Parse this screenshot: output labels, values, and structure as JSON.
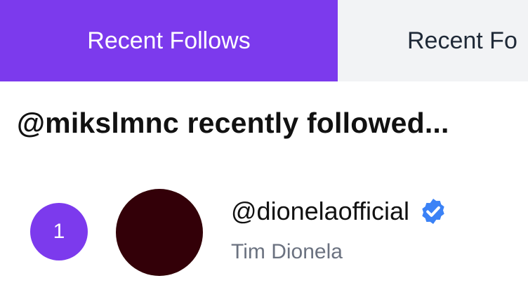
{
  "tabs": [
    {
      "label": "Recent Follows",
      "active": true
    },
    {
      "label": "Recent Fo",
      "active": false
    }
  ],
  "heading": "@mikslmnc recently followed...",
  "follows": [
    {
      "rank": "1",
      "handle": "@dionelaofficial",
      "display_name": "Tim Dionela",
      "verified": true,
      "avatar_color": "#330008"
    }
  ],
  "colors": {
    "accent": "#7c3aed",
    "inactive_tab_bg": "#f2f3f5",
    "verified_badge": "#3b82f6",
    "muted_text": "#6b7280"
  },
  "icons": {
    "verified": "verified-badge-icon"
  }
}
